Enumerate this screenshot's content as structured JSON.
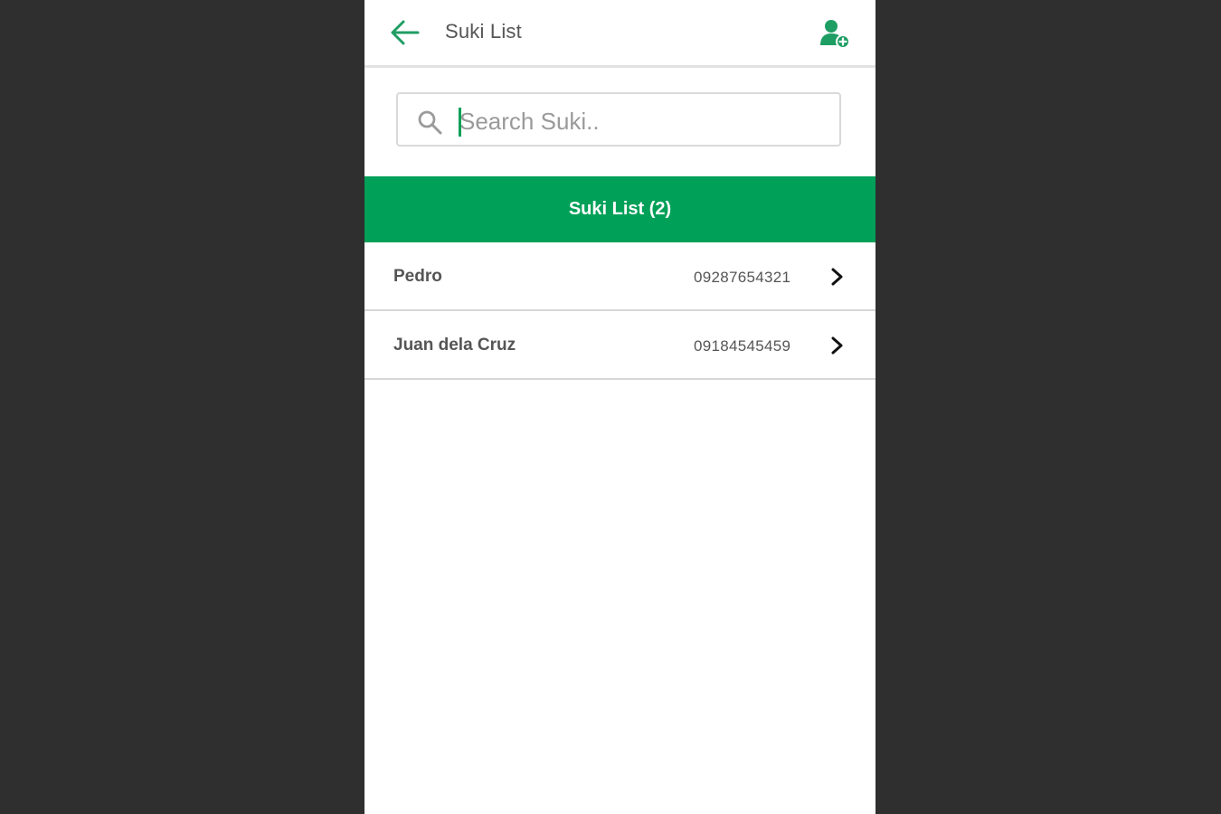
{
  "appbar": {
    "title": "Suki List",
    "back_icon": "arrow-left-icon",
    "add_icon": "add-user-icon",
    "accent_color": "#00a058"
  },
  "search": {
    "value": "",
    "placeholder": "Search Suki..",
    "icon": "search-icon"
  },
  "section": {
    "label": "Suki List (2)",
    "background": "#00a058"
  },
  "suki_list": [
    {
      "name": "Pedro",
      "phone": "09287654321",
      "icon": "chevron-right-icon"
    },
    {
      "name": "Juan dela Cruz",
      "phone": "09184545459",
      "icon": "chevron-right-icon"
    }
  ]
}
